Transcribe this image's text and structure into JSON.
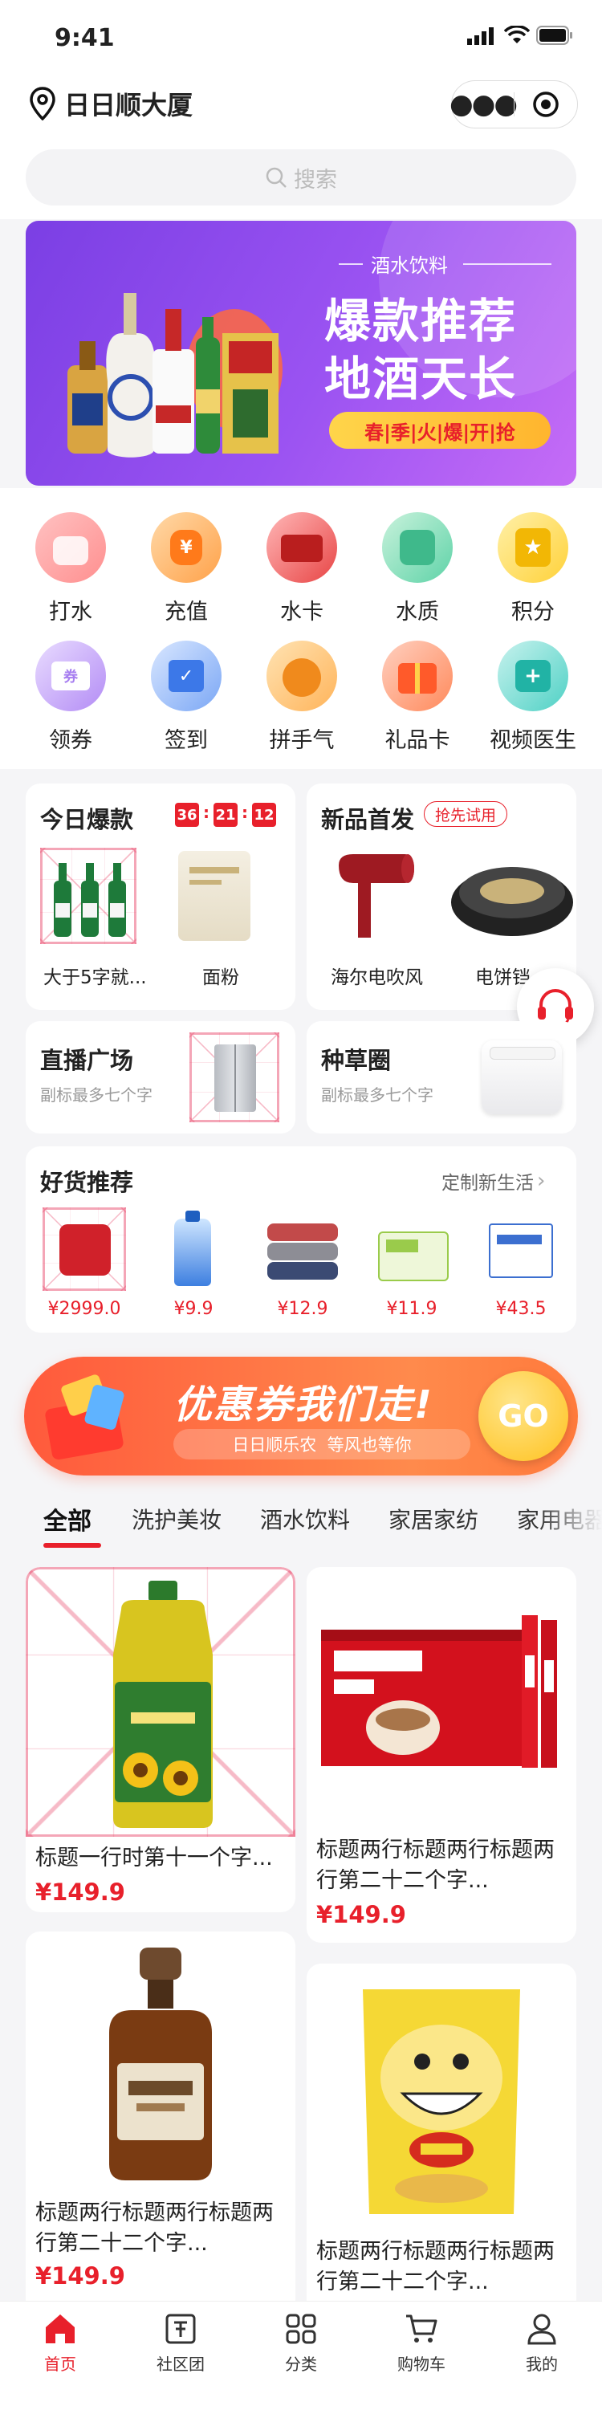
{
  "status_bar": {
    "time": "9:41"
  },
  "header": {
    "location": "日日顺大厦"
  },
  "search": {
    "placeholder": "搜索"
  },
  "banner": {
    "tag": "酒水饮料",
    "line1": "爆款推荐",
    "line2": "地酒天长",
    "slogan": "春|季|火|爆|开|抢"
  },
  "quick_icons": [
    {
      "label": "打水",
      "icon": "water-jug-icon"
    },
    {
      "label": "充值",
      "icon": "money-bag-icon"
    },
    {
      "label": "水卡",
      "icon": "card-icon"
    },
    {
      "label": "水质",
      "icon": "water-quality-icon"
    },
    {
      "label": "积分",
      "icon": "star-badge-icon"
    },
    {
      "label": "领券",
      "icon": "coupon-icon"
    },
    {
      "label": "签到",
      "icon": "calendar-check-icon"
    },
    {
      "label": "拼手气",
      "icon": "gauge-icon"
    },
    {
      "label": "礼品卡",
      "icon": "gift-icon"
    },
    {
      "label": "视频医生",
      "icon": "medical-kit-icon"
    }
  ],
  "today_hot": {
    "title": "今日爆款",
    "countdown": [
      "36",
      "21",
      "12"
    ],
    "sep": ":",
    "items": [
      {
        "name": "大于5字就...",
        "image": "beer-bottles"
      },
      {
        "name": "面粉",
        "image": "flour-bag"
      }
    ]
  },
  "new_arrivals": {
    "title": "新品首发",
    "badge": "抢先试用",
    "items": [
      {
        "name": "海尔电吹风",
        "image": "hair-dryer"
      },
      {
        "name": "电饼铛",
        "image": "pancake-maker"
      }
    ]
  },
  "live_square": {
    "title": "直播广场",
    "subtitle": "副标最多七个字"
  },
  "grass_circle": {
    "title": "种草圈",
    "subtitle": "副标最多七个字"
  },
  "good_goods": {
    "title": "好货推荐",
    "more": "定制新生活",
    "items": [
      {
        "price": "¥2999.0",
        "image": "air-fryer"
      },
      {
        "price": "¥9.9",
        "image": "detergent"
      },
      {
        "price": "¥12.9",
        "image": "towels"
      },
      {
        "price": "¥11.9",
        "image": "tissues"
      },
      {
        "price": "¥43.5",
        "image": "milk-box"
      }
    ]
  },
  "coupon_banner": {
    "title": "优惠券我们走!",
    "subtitle": "日日顺乐农  等风也等你",
    "button": "GO"
  },
  "category_tabs": [
    "全部",
    "洗护美妆",
    "酒水饮料",
    "家居家纺",
    "家用电器"
  ],
  "products": [
    {
      "title": "标题一行时第十一个字...",
      "price": "¥149.9"
    },
    {
      "title": "标题两行标题两行标题两行第二十二个字...",
      "price": "¥149.9"
    },
    {
      "title": "标题两行标题两行标题两行第二十二个字...",
      "price": "¥149.9"
    },
    {
      "title": "标题两行标题两行标题两行第二十二个字...",
      "price": ""
    }
  ],
  "bottom_nav": [
    {
      "label": "首页",
      "icon": "home-icon",
      "active": true
    },
    {
      "label": "社区团",
      "icon": "community-icon",
      "active": false
    },
    {
      "label": "分类",
      "icon": "category-grid-icon",
      "active": false
    },
    {
      "label": "购物车",
      "icon": "cart-icon",
      "active": false
    },
    {
      "label": "我的",
      "icon": "profile-icon",
      "active": false
    }
  ],
  "colors": {
    "accent": "#e8202b",
    "banner_purple": "#8a4cf0",
    "coupon_orange": "#ff5a3c"
  }
}
